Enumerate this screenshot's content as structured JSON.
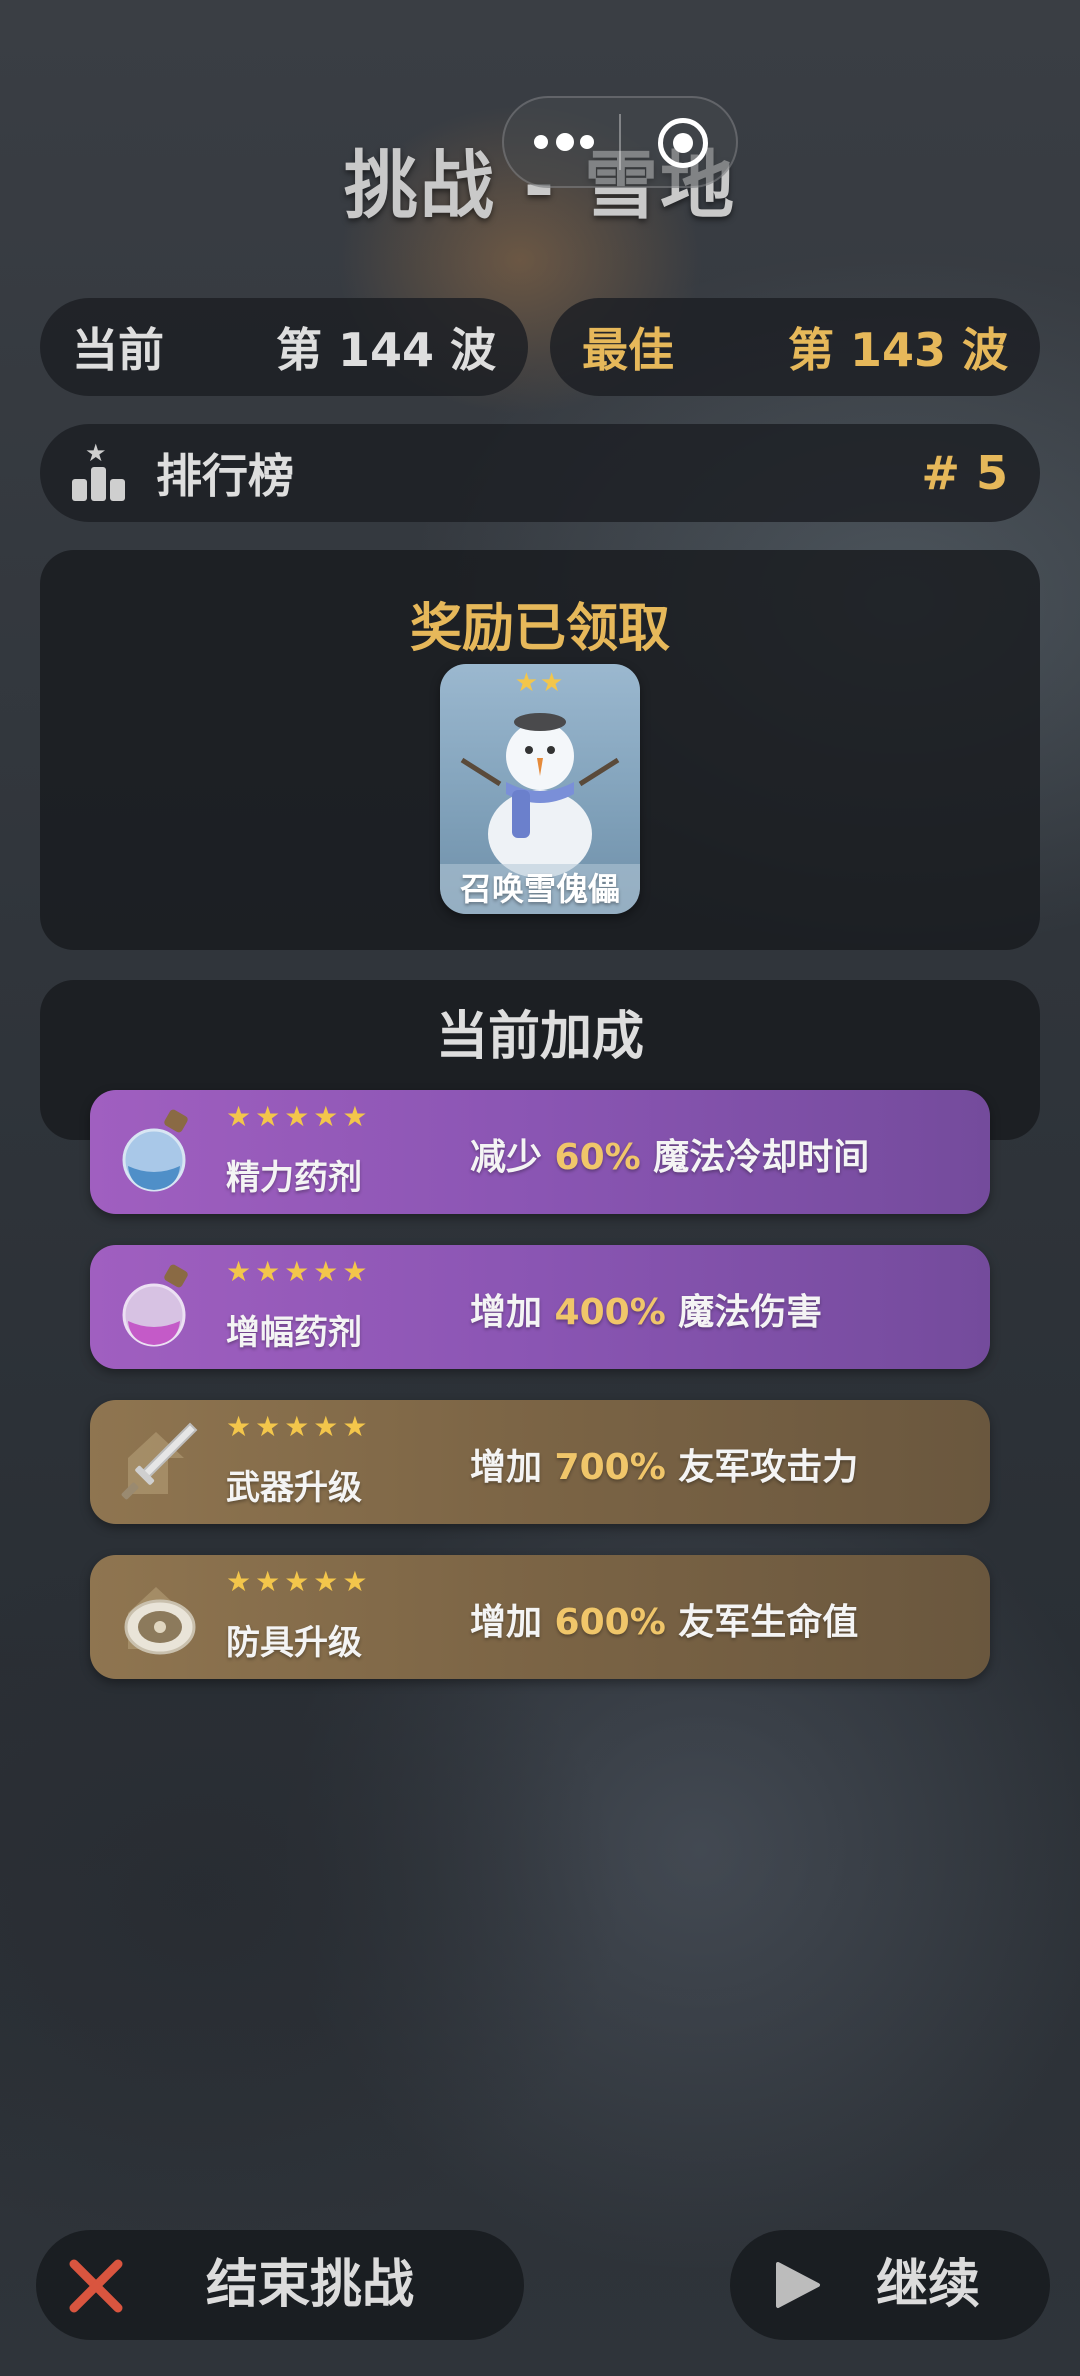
{
  "title": "挑战 - 雪地",
  "stats": {
    "current_label": "当前",
    "current_value": "第 144 波",
    "best_label": "最佳",
    "best_value": "第 143 波"
  },
  "leaderboard": {
    "label": "排行榜",
    "rank": "# 5"
  },
  "reward": {
    "title": "奖励已领取",
    "card_label": "召唤雪傀儡",
    "card_stars": "★★"
  },
  "bonus": {
    "title": "当前加成",
    "items": [
      {
        "name": "精力药剂",
        "stars": "★★★★★",
        "prefix": "减少 ",
        "value": "60%",
        "suffix": " 魔法冷却时间",
        "icon": "blue-potion-icon"
      },
      {
        "name": "增幅药剂",
        "stars": "★★★★★",
        "prefix": "增加 ",
        "value": "400%",
        "suffix": " 魔法伤害",
        "icon": "purple-potion-icon"
      },
      {
        "name": "武器升级",
        "stars": "★★★★★",
        "prefix": "增加 ",
        "value": "700%",
        "suffix": " 友军攻击力",
        "icon": "sword-upgrade-icon"
      },
      {
        "name": "防具升级",
        "stars": "★★★★★",
        "prefix": "增加 ",
        "value": "600%",
        "suffix": " 友军生命值",
        "icon": "shield-upgrade-icon"
      }
    ]
  },
  "buttons": {
    "end_label": "结束挑战",
    "continue_label": "继续"
  },
  "colors": {
    "gold": "#e6b85a",
    "purple_row": "#8a55b3",
    "brown_row": "#7b6445",
    "close_red": "#d9553f"
  }
}
